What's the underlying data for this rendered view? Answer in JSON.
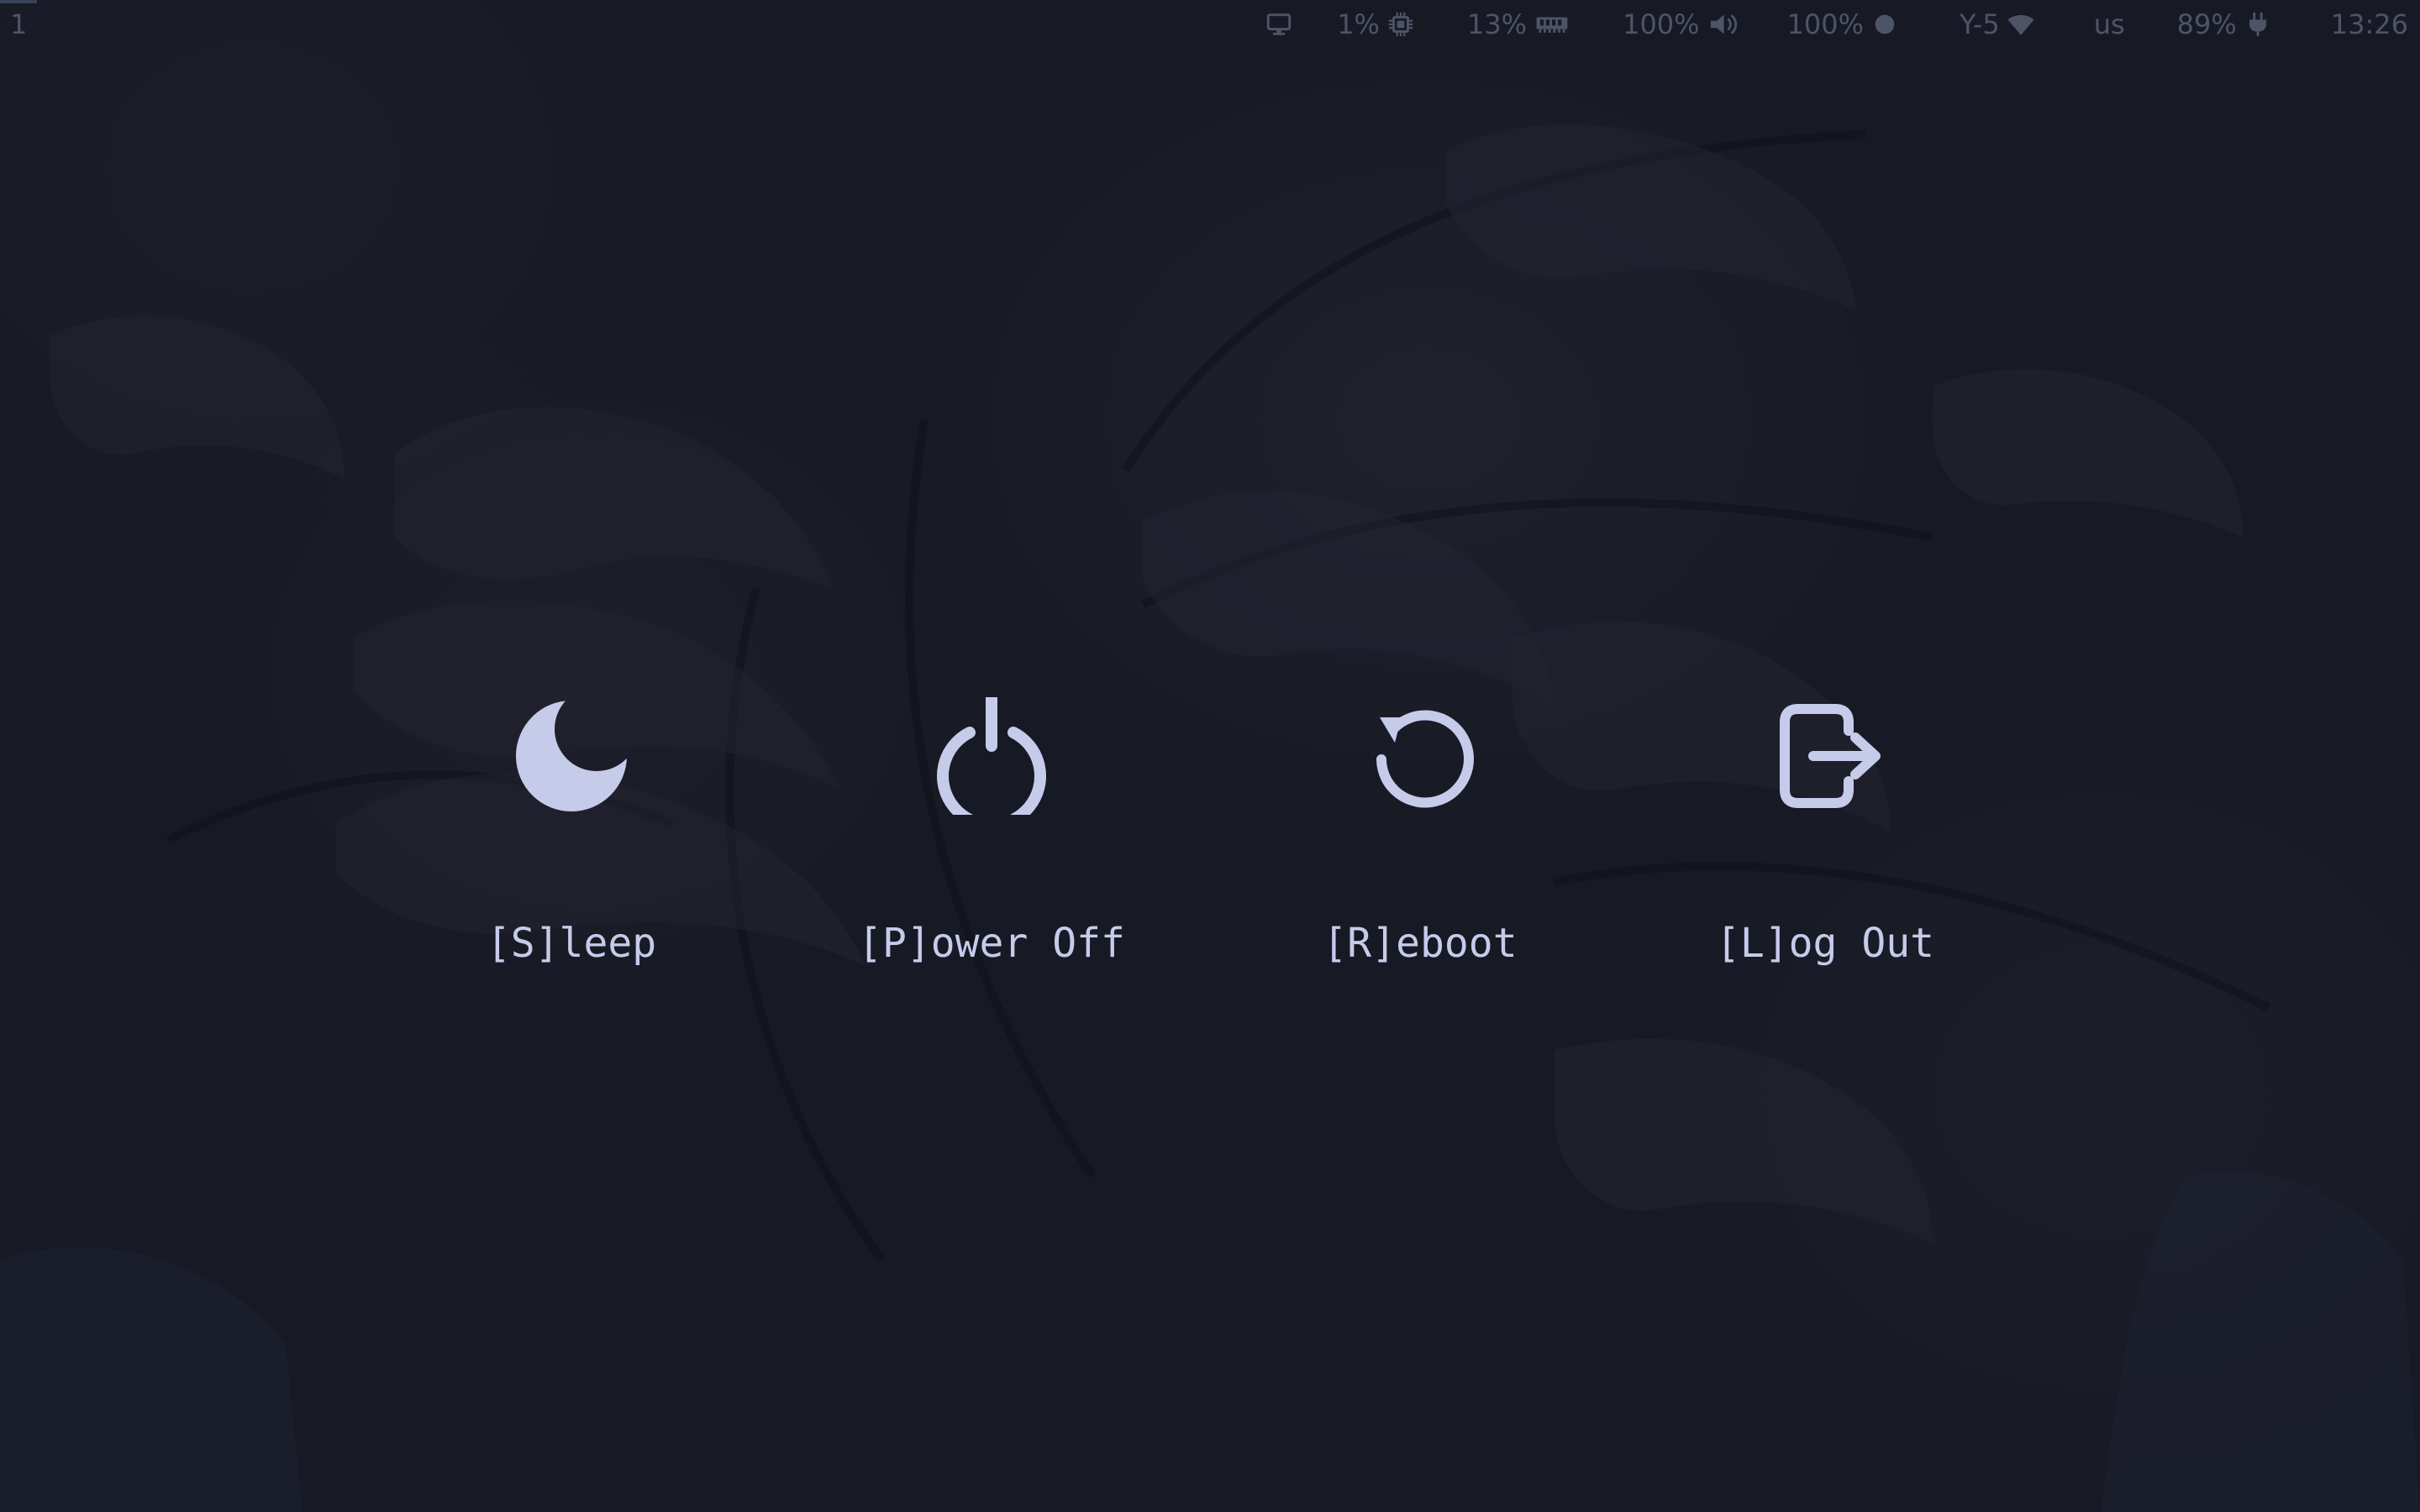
{
  "topbar": {
    "workspace": "1",
    "cpu": "1%",
    "memory": "13%",
    "volume": "100%",
    "brightness": "100%",
    "network": "Y-5",
    "keyboard_layout": "us",
    "battery": "89%",
    "clock": "13:26",
    "icons": [
      "monitor-icon",
      "cpu-icon",
      "memory-icon",
      "volume-icon",
      "brightness-icon",
      "wifi-icon",
      "plug-icon"
    ]
  },
  "power_menu": {
    "accent_color": "#c6cbea",
    "items": [
      {
        "label": "[S]leep",
        "icon": "moon-icon"
      },
      {
        "label": "[P]ower Off",
        "icon": "power-icon"
      },
      {
        "label": "[R]eboot",
        "icon": "reboot-icon"
      },
      {
        "label": "[L]og Out",
        "icon": "logout-icon"
      }
    ]
  }
}
